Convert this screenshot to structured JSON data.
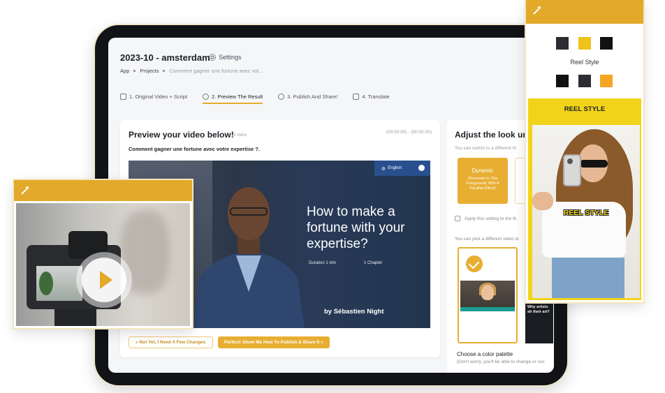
{
  "app": {
    "title": "2023-10 - amsterdam",
    "settings_label": "Settings"
  },
  "breadcrumb": [
    "App",
    "Projects",
    "Comment gagner une fortune avec vot..."
  ],
  "steps": [
    {
      "label": "1. Original Video + Script",
      "icon": "video-icon",
      "active": false
    },
    {
      "label": "2. Preview The Result",
      "icon": "play-circle-icon",
      "active": true
    },
    {
      "label": "3. Publish And Share!",
      "icon": "play-circle-icon",
      "active": false
    },
    {
      "label": "4. Translate",
      "icon": "translate-icon",
      "active": false
    }
  ],
  "preview": {
    "title": "Preview your video below!",
    "duration": "1 mins",
    "timecode": "(00:00:00) - (00:00:00)",
    "subtitle": "Comment gagner une fortune avec votre expertise ?.",
    "video": {
      "language": "English",
      "heading": "How to make a fortune with your expertise?",
      "duration_meta": "Duration 1 min",
      "chapters_meta": "1 Chapter",
      "author": "by Sébastien Night"
    },
    "buttons": {
      "not_yet": "« Not Yet, I Need A Few Changes",
      "perfect": "Perfect! Show Me How To Publish & Share It »"
    }
  },
  "adjust": {
    "title": "Adjust the look un",
    "note": "You can switch to a different th",
    "dynamic_title": "Dynamic",
    "dynamic_desc": "(Presenter In The Foreground, With A Parallax Effect)",
    "apply_label": "Apply this setting to the th",
    "pick_label": "You can pick a different video st",
    "style_card2_heading": "Why artists sh their art?",
    "palette_title": "Choose a color palette",
    "palette_sub": "(Don't worry, you'll be able to change or cus"
  },
  "reel_panel": {
    "swatches_top": [
      "#2b2d33",
      "#f0c21c",
      "#111111"
    ],
    "swatches_bottom": [
      "#111111",
      "#2b2d33",
      "#f5a524"
    ],
    "style_label": "Reel Style",
    "reel_title": "REEL STYLE",
    "reel_caption": "REEL STYLE"
  },
  "colors": {
    "accent": "#e2a92a",
    "reel_yellow": "#f1d41a"
  }
}
